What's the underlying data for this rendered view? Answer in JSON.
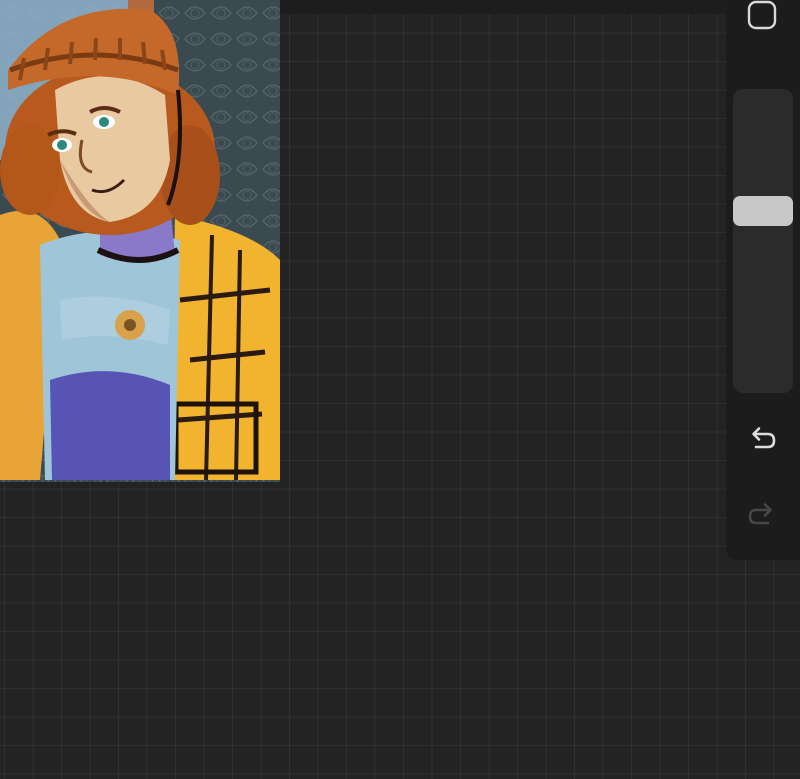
{
  "app": {
    "canvas_background": "#232323",
    "accent": "#c8c8c8"
  },
  "artwork": {
    "description_icon": "painting-canvas",
    "palette": [
      "#b85a1e",
      "#e8c9a0",
      "#9fc6d8",
      "#f2b42e",
      "#4a3fb0",
      "#2b6d3a"
    ]
  },
  "sidebar": {
    "modify_icon": "square-icon",
    "size_slider": {
      "value": 0.39
    },
    "undo_icon": "undo-arrow-icon",
    "redo_icon": "redo-arrow-icon",
    "redo_enabled": false
  }
}
